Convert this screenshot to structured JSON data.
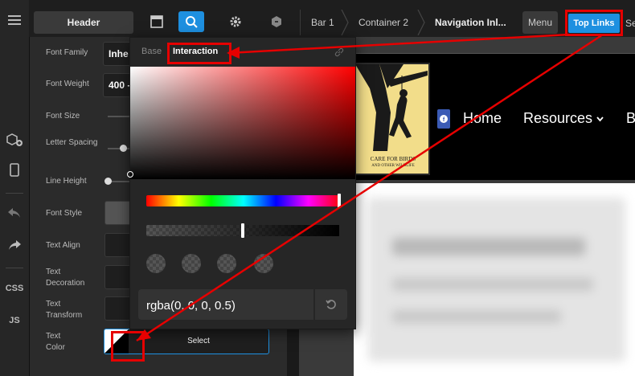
{
  "toolbar": {
    "header_label": "Header",
    "breadcrumbs": [
      "Bar 1",
      "Container 2",
      "Navigation Inl..."
    ],
    "menu_label": "Menu",
    "top_links_label": "Top Links",
    "trailing_text": "Se"
  },
  "rail": {
    "css_label": "CSS",
    "js_label": "JS"
  },
  "panel": {
    "font_family_label": "Font Family",
    "font_family_value": "Inhe",
    "font_weight_label": "Font Weight",
    "font_weight_value": "400 -",
    "font_size_label": "Font Size",
    "letter_spacing_label": "Letter Spacing",
    "line_height_label": "Line Height",
    "font_style_label": "Font Style",
    "text_align_label": "Text Align",
    "text_decoration_label": "Text Decoration",
    "text_transform_label": "Text Transform",
    "text_color_label": "Text Color",
    "text_color_button": "Select"
  },
  "picker": {
    "tab_base": "Base",
    "tab_interaction": "Interaction",
    "value": "rgba(0, 0, 0, 0.5)",
    "hue": 0,
    "alpha": 0.5
  },
  "site": {
    "nav_home": "Home",
    "nav_resources": "Resources",
    "nav_next": "B",
    "logo_text_1": "CARE FOR BIRDS",
    "logo_text_2": "AND OTHER WILDLIFE"
  },
  "colors": {
    "accent": "#1e90e0",
    "annotation": "#e60000"
  }
}
